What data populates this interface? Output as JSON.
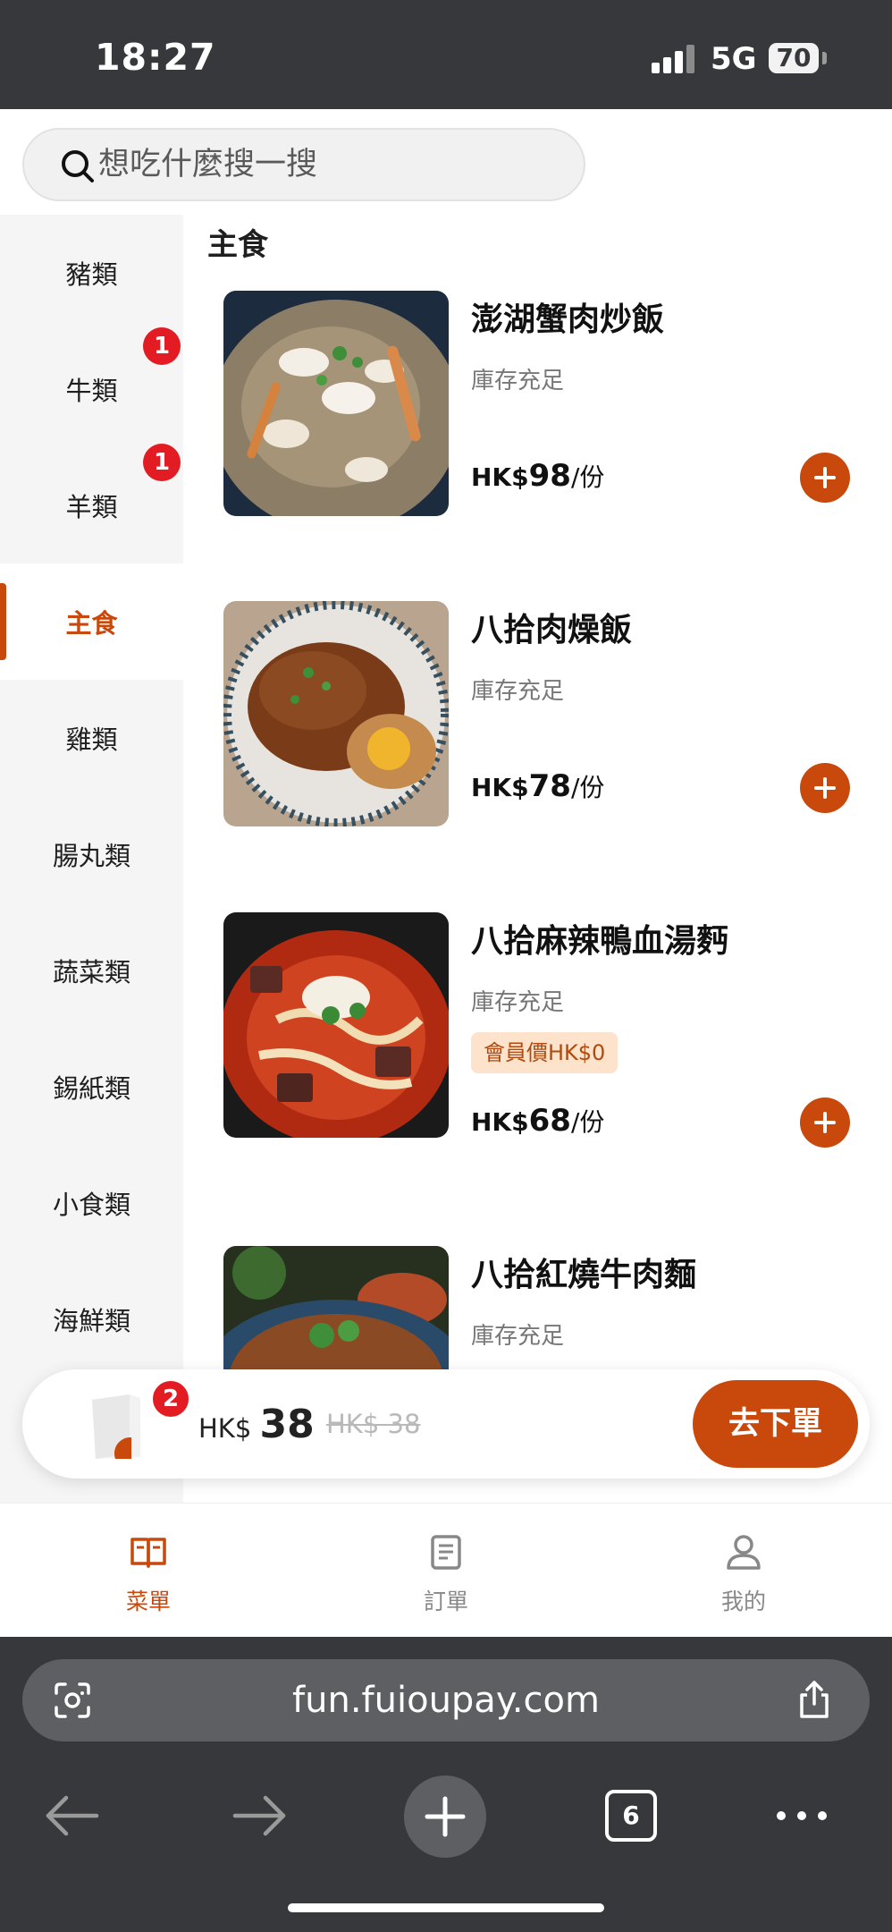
{
  "status_bar": {
    "time": "18:27",
    "network": "5G",
    "battery": "70"
  },
  "search": {
    "placeholder": "想吃什麼搜一搜"
  },
  "sidebar": {
    "categories": [
      {
        "label": "豬類",
        "badge": ""
      },
      {
        "label": "牛類",
        "badge": "1"
      },
      {
        "label": "羊類",
        "badge": "1"
      },
      {
        "label": "主食",
        "badge": "",
        "active": true
      },
      {
        "label": "雞類",
        "badge": ""
      },
      {
        "label": "腸丸類",
        "badge": ""
      },
      {
        "label": "蔬菜類",
        "badge": ""
      },
      {
        "label": "錫紙類",
        "badge": ""
      },
      {
        "label": "小食類",
        "badge": ""
      },
      {
        "label": "海鮮類",
        "badge": ""
      }
    ]
  },
  "main": {
    "section_title": "主食",
    "items": [
      {
        "name": "澎湖蟹肉炒飯",
        "stock": "庫存充足",
        "price_prefix": "HK$",
        "price": "98",
        "unit": "/份",
        "member_price": ""
      },
      {
        "name": "八拾肉燥飯",
        "stock": "庫存充足",
        "price_prefix": "HK$",
        "price": "78",
        "unit": "/份",
        "member_price": ""
      },
      {
        "name": "八拾麻辣鴨血湯麪",
        "stock": "庫存充足",
        "price_prefix": "HK$",
        "price": "68",
        "unit": "/份",
        "member_price": "會員價HK$0"
      },
      {
        "name": "八拾紅燒牛肉麵",
        "stock": "庫存充足"
      }
    ]
  },
  "cart": {
    "count": "2",
    "currency": "HK$",
    "total": "38",
    "original": "HK$ 38",
    "checkout_label": "去下單"
  },
  "tabbar": {
    "tabs": [
      {
        "label": "菜單",
        "icon": "menu-book-icon",
        "active": true
      },
      {
        "label": "訂單",
        "icon": "order-list-icon"
      },
      {
        "label": "我的",
        "icon": "profile-icon"
      }
    ]
  },
  "browser": {
    "url": "fun.fuioupay.com",
    "tab_count": "6"
  },
  "colors": {
    "accent": "#c9480b",
    "badge": "#e31b23",
    "chrome": "#36383b"
  }
}
